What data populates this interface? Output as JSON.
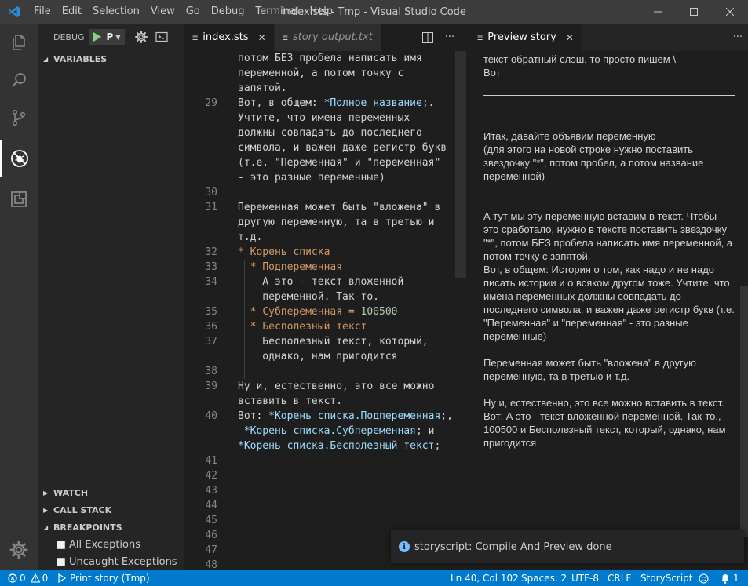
{
  "titlebar": {
    "menu": [
      "File",
      "Edit",
      "Selection",
      "View",
      "Go",
      "Debug",
      "Terminal",
      "Help"
    ],
    "title": "index.sts - Tmp - Visual Studio Code"
  },
  "colors": {
    "accent": "#007acc",
    "activity_bar": "#333333",
    "sidebar": "#252526",
    "editor": "#1e1e1e",
    "play": "#89d185"
  },
  "activitybar": {
    "icons": [
      "explorer-icon",
      "search-icon",
      "source-control-icon",
      "debug-icon",
      "extensions-icon",
      "settings-gear-icon"
    ]
  },
  "sidebar": {
    "debug_label": "DEBUG",
    "config_name": "P",
    "sections": {
      "variables": "VARIABLES",
      "watch": "WATCH",
      "call_stack": "CALL STACK",
      "breakpoints": "BREAKPOINTS"
    },
    "breakpoints": [
      "All Exceptions",
      "Uncaught Exceptions"
    ]
  },
  "editor1": {
    "tabs": [
      {
        "label": "index.sts",
        "close": "✕"
      },
      {
        "label": "story output.txt"
      }
    ],
    "lines": [
      {
        "n": "",
        "t": "потом БЕЗ пробела написать имя"
      },
      {
        "n": "",
        "t": "переменной, а потом точку с"
      },
      {
        "n": "",
        "t": "запятой."
      },
      {
        "n": "29",
        "a": "Вот, в общем: ",
        "b": "*Полное название",
        "c": ";."
      },
      {
        "n": "",
        "t": "Учтите, что имена переменных"
      },
      {
        "n": "",
        "t": "должны совпадать до последнего"
      },
      {
        "n": "",
        "t": "символа, и важен даже регистр букв"
      },
      {
        "n": "",
        "t": "(т.е. \"Переменная\" и \"переменная\""
      },
      {
        "n": "",
        "t": "- это разные переменные)"
      },
      {
        "n": "30",
        "t": ""
      },
      {
        "n": "31",
        "t": "Переменная может быть \"вложена\" в"
      },
      {
        "n": "",
        "t": "другую переменную, та в третью и"
      },
      {
        "n": "",
        "t": "т.д."
      },
      {
        "n": "32",
        "s": "* ",
        "v": "Корень списка"
      },
      {
        "n": "33",
        "s": "  * ",
        "v": "Подпеременная"
      },
      {
        "n": "34",
        "t": "    А это - текст вложенной"
      },
      {
        "n": "",
        "t": "    переменной. Так-то."
      },
      {
        "n": "35",
        "s": "  * ",
        "v": "Субпеременная = ",
        "num": "100500"
      },
      {
        "n": "36",
        "s": "  * ",
        "v": "Бесполезный текст"
      },
      {
        "n": "37",
        "t": "    Бесполезный текст, который,"
      },
      {
        "n": "",
        "t": "    однако, нам пригодится"
      },
      {
        "n": "38",
        "t": ""
      },
      {
        "n": "39",
        "t": "Ну и, естественно, это все можно"
      },
      {
        "n": "",
        "t": "вставить в текст."
      },
      {
        "n": "40",
        "a": "Вот: ",
        "b": "*Корень списка.Подпеременная",
        "c": ";,"
      },
      {
        "n": "",
        "a": " ",
        "b": "*Корень списка.Субпеременная",
        "c": "; и"
      },
      {
        "n": "",
        "b": "*Корень списка.Бесполезный текст",
        "c": ";"
      },
      {
        "n": "41",
        "t": ""
      },
      {
        "n": "42",
        "t": ""
      },
      {
        "n": "43",
        "t": ""
      },
      {
        "n": "44",
        "t": ""
      },
      {
        "n": "45",
        "t": ""
      },
      {
        "n": "46",
        "t": ""
      },
      {
        "n": "47",
        "t": ""
      },
      {
        "n": "48",
        "t": ""
      }
    ]
  },
  "editor2": {
    "tab": "Preview story",
    "tab_close": "✕",
    "paragraphs": [
      "текст обратный слэш, то просто пишем \\\nВот",
      "",
      "Итак, давайте объявим переменную\n(для этого на новой строке нужно поставить звездочку \"*\", потом пробел, а потом название переменной)",
      "А тут мы эту переменную вставим в текст. Чтобы это сработало, нужно в тексте поставить звездочку \"*\", потом БЕЗ пробела написать имя переменной, а потом точку с запятой.\nВот, в общем: История о том, как надо и не надо писать истории и о всяком другом тоже. Учтите, что имена переменных должны совпадать до последнего символа, и важен даже регистр букв (т.е. \"Переменная\" и \"переменная\" - это разные переменные)",
      "Переменная может быть \"вложена\" в другую переменную, та в третью и т.д.",
      "Ну и, естественно, это все можно вставить в текст.\nВот: А это - текст вложенной переменной. Так-то., 100500 и Бесполезный текст, который, однако, нам пригодится"
    ]
  },
  "notification": {
    "text": "storyscript: Compile And Preview done"
  },
  "statusbar": {
    "errors": "0",
    "warnings": "0",
    "debug_target": "Print story (Tmp)",
    "position": "Ln 40, Col 102",
    "spaces": "Spaces: 2",
    "encoding": "UTF-8",
    "eol": "CRLF",
    "language": "StoryScript",
    "notifications": "1"
  }
}
